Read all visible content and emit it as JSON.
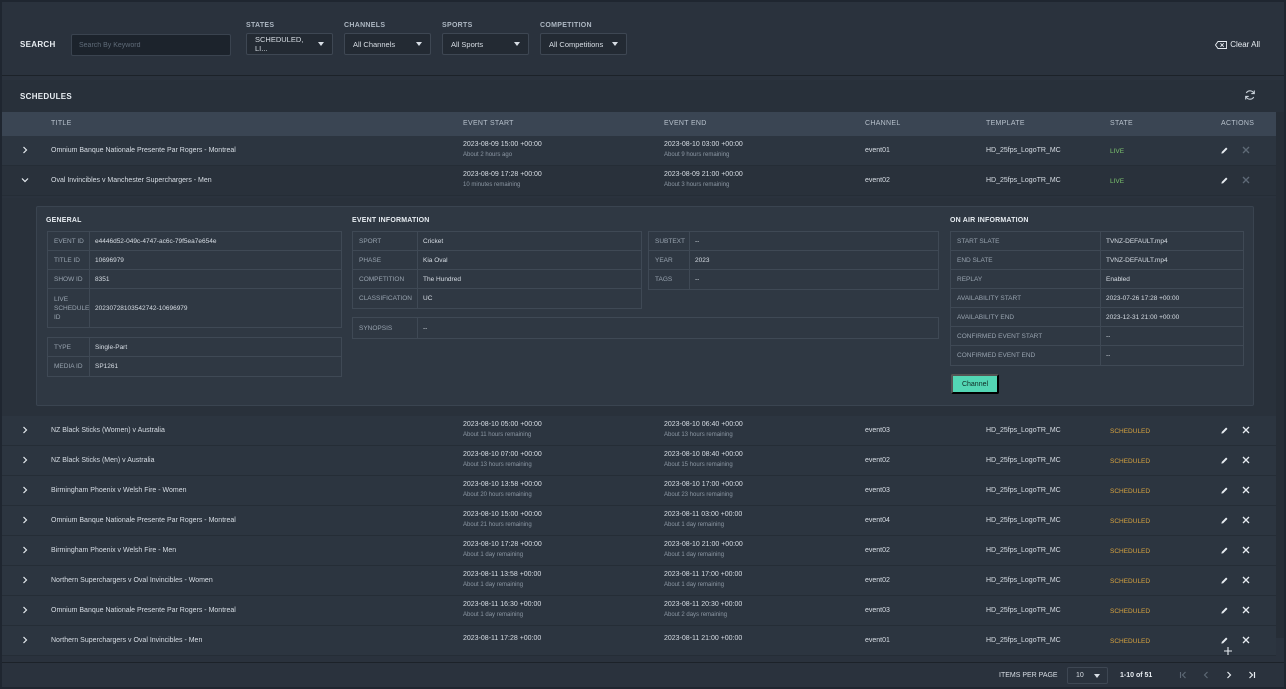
{
  "filters": {
    "search_label": "SEARCH",
    "search_placeholder": "Search By Keyword",
    "states_label": "STATES",
    "states_value": "SCHEDULED, LI...",
    "channels_label": "CHANNELS",
    "channels_value": "All Channels",
    "sports_label": "SPORTS",
    "sports_value": "All Sports",
    "competition_label": "COMPETITION",
    "competition_value": "All Competitions",
    "clear_all": "Clear All"
  },
  "schedules": {
    "title": "SCHEDULES",
    "columns": {
      "title": "TITLE",
      "event_start": "EVENT START",
      "event_end": "EVENT END",
      "channel": "CHANNEL",
      "template": "TEMPLATE",
      "state": "STATE",
      "actions": "ACTIONS"
    },
    "rows": [
      {
        "title": "Omnium Banque Nationale Presente Par Rogers - Montreal",
        "start": "2023-08-09 15:00 +00:00",
        "start_rel": "About 2 hours ago",
        "end": "2023-08-10 03:00 +00:00",
        "end_rel": "About 9 hours remaining",
        "channel": "event01",
        "template": "HD_25fps_LogoTR_MC",
        "state": "LIVE"
      },
      {
        "title": "Oval Invincibles v Manchester Superchargers - Men",
        "start": "2023-08-09 17:28 +00:00",
        "start_rel": "10 minutes remaining",
        "end": "2023-08-09 21:00 +00:00",
        "end_rel": "About 3 hours remaining",
        "channel": "event02",
        "template": "HD_25fps_LogoTR_MC",
        "state": "LIVE"
      },
      {
        "title": "NZ Black Sticks (Women) v Australia",
        "start": "2023-08-10 05:00 +00:00",
        "start_rel": "About 11 hours remaining",
        "end": "2023-08-10 06:40 +00:00",
        "end_rel": "About 13 hours remaining",
        "channel": "event03",
        "template": "HD_25fps_LogoTR_MC",
        "state": "SCHEDULED"
      },
      {
        "title": "NZ Black Sticks (Men) v Australia",
        "start": "2023-08-10 07:00 +00:00",
        "start_rel": "About 13 hours remaining",
        "end": "2023-08-10 08:40 +00:00",
        "end_rel": "About 15 hours remaining",
        "channel": "event02",
        "template": "HD_25fps_LogoTR_MC",
        "state": "SCHEDULED"
      },
      {
        "title": "Birmingham Phoenix v Welsh Fire - Women",
        "start": "2023-08-10 13:58 +00:00",
        "start_rel": "About 20 hours remaining",
        "end": "2023-08-10 17:00 +00:00",
        "end_rel": "About 23 hours remaining",
        "channel": "event03",
        "template": "HD_25fps_LogoTR_MC",
        "state": "SCHEDULED"
      },
      {
        "title": "Omnium Banque Nationale Presente Par Rogers - Montreal",
        "start": "2023-08-10 15:00 +00:00",
        "start_rel": "About 21 hours remaining",
        "end": "2023-08-11 03:00 +00:00",
        "end_rel": "About 1 day remaining",
        "channel": "event04",
        "template": "HD_25fps_LogoTR_MC",
        "state": "SCHEDULED"
      },
      {
        "title": "Birmingham Phoenix v Welsh Fire - Men",
        "start": "2023-08-10 17:28 +00:00",
        "start_rel": "About 1 day remaining",
        "end": "2023-08-10 21:00 +00:00",
        "end_rel": "About 1 day remaining",
        "channel": "event02",
        "template": "HD_25fps_LogoTR_MC",
        "state": "SCHEDULED"
      },
      {
        "title": "Northern Superchargers v Oval Invincibles - Women",
        "start": "2023-08-11 13:58 +00:00",
        "start_rel": "About 1 day remaining",
        "end": "2023-08-11 17:00 +00:00",
        "end_rel": "About 1 day remaining",
        "channel": "event02",
        "template": "HD_25fps_LogoTR_MC",
        "state": "SCHEDULED"
      },
      {
        "title": "Omnium Banque Nationale Presente Par Rogers - Montreal",
        "start": "2023-08-11 16:30 +00:00",
        "start_rel": "About 1 day remaining",
        "end": "2023-08-11 20:30 +00:00",
        "end_rel": "About 2 days remaining",
        "channel": "event03",
        "template": "HD_25fps_LogoTR_MC",
        "state": "SCHEDULED"
      },
      {
        "title": "Northern Superchargers v Oval Invincibles - Men",
        "start": "2023-08-11 17:28 +00:00",
        "start_rel": "",
        "end": "2023-08-11 21:00 +00:00",
        "end_rel": "",
        "channel": "event01",
        "template": "HD_25fps_LogoTR_MC",
        "state": "SCHEDULED"
      }
    ]
  },
  "detail": {
    "general_title": "GENERAL",
    "event_info_title": "EVENT INFORMATION",
    "on_air_title": "ON AIR INFORMATION",
    "general": [
      {
        "k": "EVENT ID",
        "v": "e4446d52-049c-4747-ac6c-79f5ea7e654e"
      },
      {
        "k": "TITLE ID",
        "v": "10696979"
      },
      {
        "k": "SHOW ID",
        "v": "8351"
      },
      {
        "k": "LIVE SCHEDULE ID",
        "v": "202307281035427​42-10696979"
      }
    ],
    "general2": [
      {
        "k": "TYPE",
        "v": "Single-Part"
      },
      {
        "k": "MEDIA ID",
        "v": "SP1261"
      }
    ],
    "event_info": [
      {
        "k": "SPORT",
        "v": "Cricket"
      },
      {
        "k": "PHASE",
        "v": "Kia Oval"
      },
      {
        "k": "COMPETITION",
        "v": "The Hundred"
      },
      {
        "k": "CLASSIFICATION",
        "v": "UC"
      }
    ],
    "event_info2": [
      {
        "k": "SUBTEXT",
        "v": "--"
      },
      {
        "k": "YEAR",
        "v": "2023"
      },
      {
        "k": "TAGS",
        "v": "--"
      }
    ],
    "synopsis": {
      "k": "SYNOPSIS",
      "v": "--"
    },
    "on_air": [
      {
        "k": "START SLATE",
        "v": "TVNZ-DEFAULT.mp4"
      },
      {
        "k": "END SLATE",
        "v": "TVNZ-DEFAULT.mp4"
      },
      {
        "k": "REPLAY",
        "v": "Enabled"
      },
      {
        "k": "AVAILABILITY START",
        "v": "2023-07-26 17:28 +00:00"
      },
      {
        "k": "AVAILABILITY END",
        "v": "2023-12-31 21:00 +00:00"
      },
      {
        "k": "CONFIRMED EVENT START",
        "v": "--"
      },
      {
        "k": "CONFIRMED EVENT END",
        "v": "--"
      }
    ],
    "channel_button": "Channel"
  },
  "footer": {
    "items_per_page_label": "ITEMS PER PAGE",
    "items_per_page_value": "10",
    "range": "1-10 of 51"
  },
  "colors": {
    "live": "#7cc36e",
    "scheduled": "#d6a23f",
    "accent": "#53d6b4"
  }
}
